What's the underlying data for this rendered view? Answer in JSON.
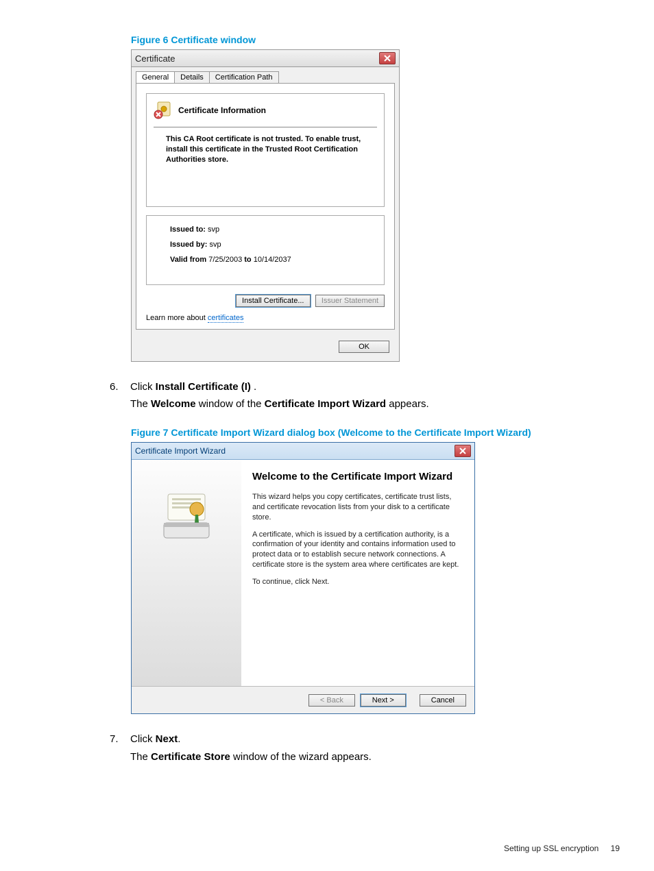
{
  "figure6": {
    "caption": "Figure 6 Certificate window",
    "window_title": "Certificate",
    "tabs": [
      "General",
      "Details",
      "Certification Path"
    ],
    "cert_info_heading": "Certificate Information",
    "trust_msg": "This CA Root certificate is not trusted. To enable trust, install this certificate in the Trusted Root Certification Authorities store.",
    "issued_to_label": "Issued to:",
    "issued_to_value": "svp",
    "issued_by_label": "Issued by:",
    "issued_by_value": "svp",
    "valid_from_label": "Valid from",
    "valid_from_value": "7/25/2003",
    "valid_to_label": "to",
    "valid_to_value": "10/14/2037",
    "install_btn": "Install Certificate...",
    "issuer_btn": "Issuer Statement",
    "learn_more_static": "Learn more about ",
    "learn_more_link": "certificates",
    "ok_btn": "OK"
  },
  "step6": {
    "number": "6.",
    "line1_pre": "Click ",
    "line1_bold": "Install Certificate (I)",
    "line1_post": " .",
    "line2_pre": "The ",
    "line2_b1": "Welcome",
    "line2_mid": " window of the ",
    "line2_b2": "Certificate Import Wizard",
    "line2_post": " appears."
  },
  "figure7": {
    "caption": "Figure 7 Certificate Import Wizard dialog box (Welcome to the Certificate Import Wizard)",
    "window_title": "Certificate Import Wizard",
    "heading": "Welcome to the Certificate Import Wizard",
    "p1": "This wizard helps you copy certificates, certificate trust lists, and certificate revocation lists from your disk to a certificate store.",
    "p2": "A certificate, which is issued by a certification authority, is a confirmation of your identity and contains information used to protect data or to establish secure network connections. A certificate store is the system area where certificates are kept.",
    "p3": "To continue, click Next.",
    "back_btn": "< Back",
    "next_btn": "Next >",
    "cancel_btn": "Cancel"
  },
  "step7": {
    "number": "7.",
    "line1_pre": "Click ",
    "line1_bold": "Next",
    "line1_post": ".",
    "line2_pre": "The ",
    "line2_b1": "Certificate Store",
    "line2_post": " window of the wizard appears."
  },
  "footer": {
    "section": "Setting up SSL encryption",
    "page": "19"
  }
}
